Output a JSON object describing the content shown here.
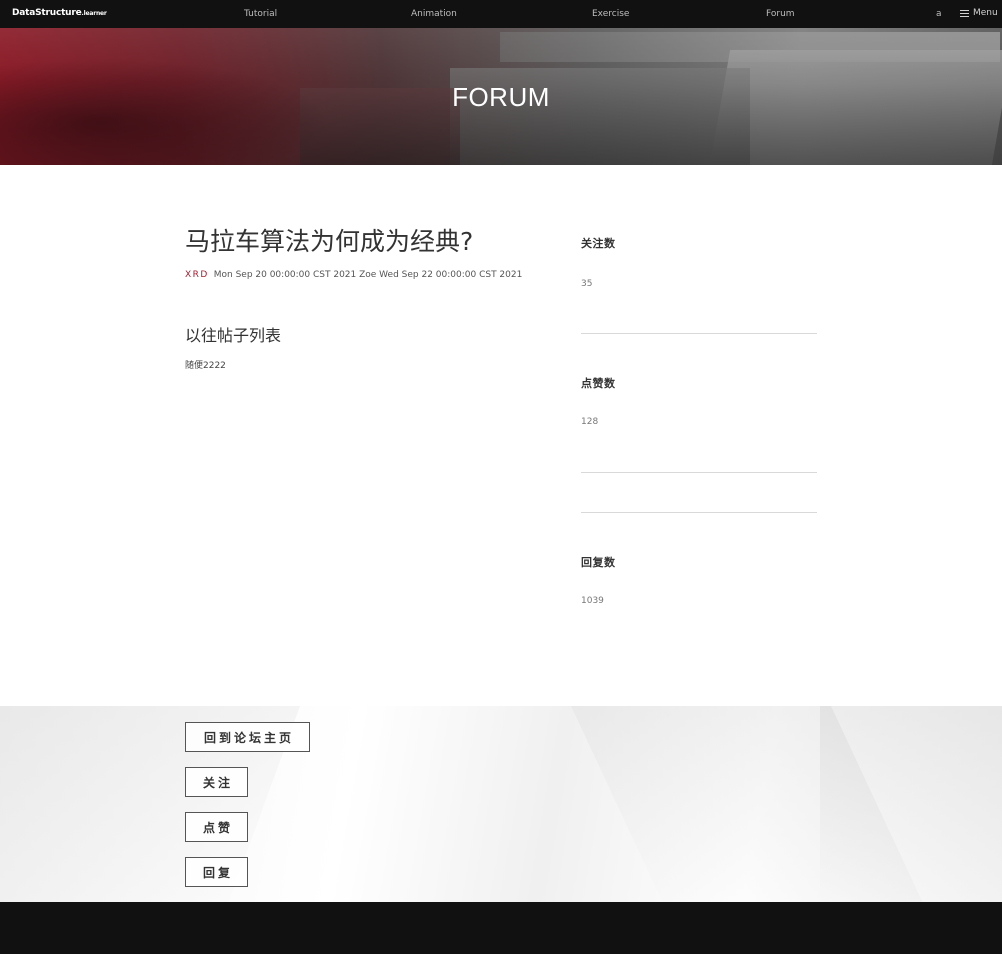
{
  "nav": {
    "brand": "DataStructure",
    "brand_suffix": ".learner",
    "links": [
      "Tutorial",
      "Animation",
      "Exercise",
      "Forum"
    ],
    "user": "a",
    "menu_label": "Menu"
  },
  "hero": {
    "title": "FORUM"
  },
  "post": {
    "title": "马拉车算法为何成为经典?",
    "author": "XRD",
    "meta_rest": "Mon Sep 20 00:00:00 CST 2021 Zoe Wed Sep 22 00:00:00 CST 2021",
    "history_title": "以往帖子列表",
    "history_items": [
      "随便2222"
    ]
  },
  "stats": {
    "follow_label": "关注数",
    "follow_value": "35",
    "like_label": "点赞数",
    "like_value": "128",
    "reply_label": "回复数",
    "reply_value": "1039"
  },
  "actions": {
    "back_label": "回到论坛主页",
    "follow_label": "关注",
    "like_label": "点赞",
    "reply_label": "回复"
  },
  "colors": {
    "accent": "#a51c30",
    "nav_bg": "#111111",
    "footer_bg": "#111111"
  }
}
